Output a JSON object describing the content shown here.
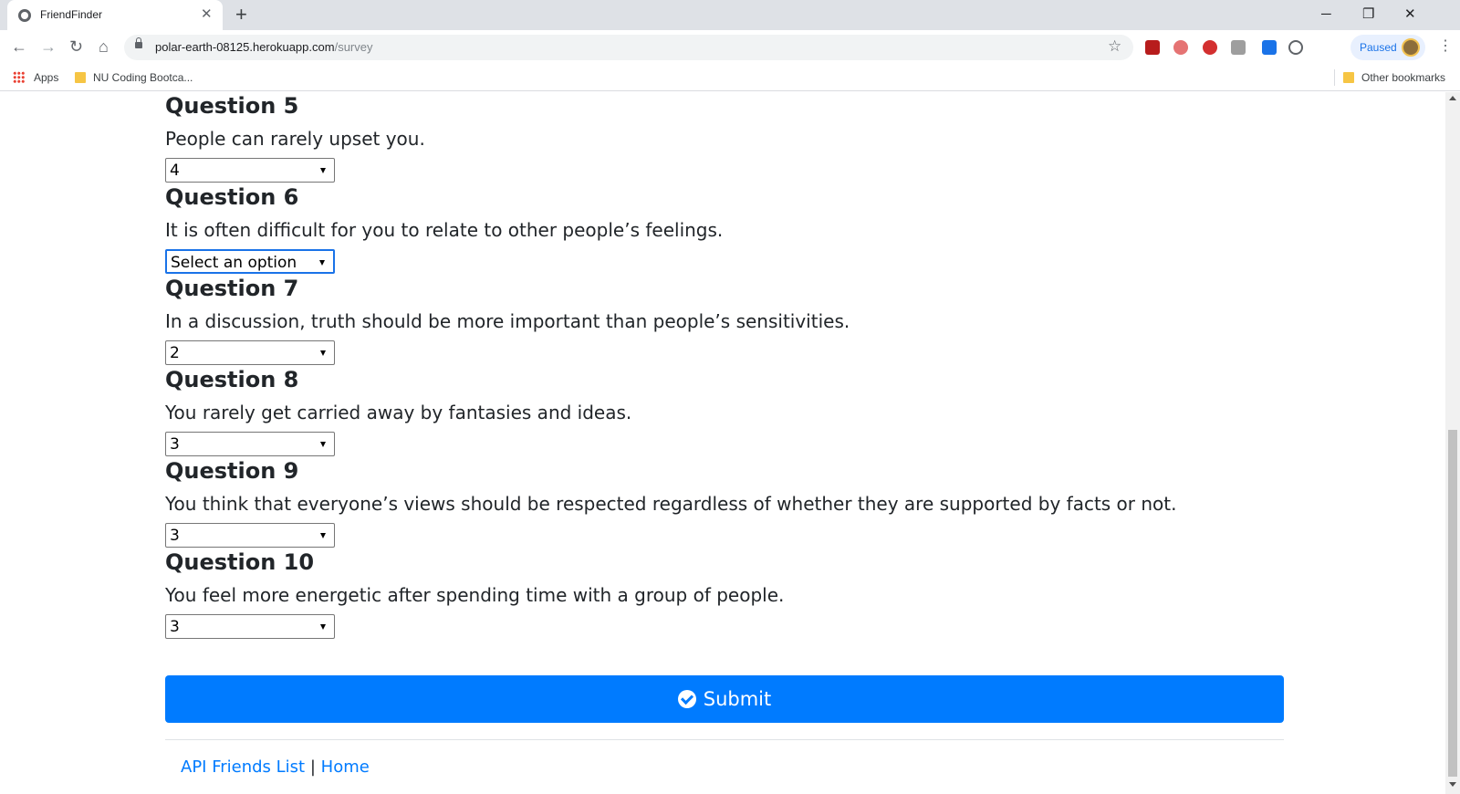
{
  "browser": {
    "tab_title": "FriendFinder",
    "tab_close": "✕",
    "new_tab": "+",
    "url_host": "polar-earth-08125.herokuapp.com",
    "url_path": "/survey",
    "profile_label": "Paused",
    "bookmarks": {
      "apps": "Apps",
      "folder1": "NU Coding Bootca...",
      "other": "Other bookmarks"
    },
    "icons": {
      "back": "←",
      "forward": "→",
      "reload": "↻",
      "home": "⌂",
      "star": "☆",
      "menu": "⋮",
      "minimize": "─",
      "restore": "❐",
      "close": "✕"
    },
    "extension_colors": [
      "#b71c1c",
      "#e57373",
      "#d32f2f",
      "#9e9e9e",
      "#1a73e8",
      "#5f6368"
    ]
  },
  "survey": {
    "questions": [
      {
        "title": "Question 5",
        "text": "People can rarely upset you.",
        "selected": "4",
        "focused": false
      },
      {
        "title": "Question 6",
        "text": "It is often difficult for you to relate to other people’s feelings.",
        "selected": "Select an option",
        "focused": true
      },
      {
        "title": "Question 7",
        "text": "In a discussion, truth should be more important than people’s sensitivities.",
        "selected": "2",
        "focused": false
      },
      {
        "title": "Question 8",
        "text": "You rarely get carried away by fantasies and ideas.",
        "selected": "3",
        "focused": false
      },
      {
        "title": "Question 9",
        "text": "You think that everyone’s views should be respected regardless of whether they are supported by facts or not.",
        "selected": "3",
        "focused": false
      },
      {
        "title": "Question 10",
        "text": "You feel more energetic after spending time with a group of people.",
        "selected": "3",
        "focused": false
      }
    ],
    "submit_label": "Submit",
    "accent_color": "#007bff"
  },
  "footer": {
    "link1": "API Friends List",
    "separator": "|",
    "link2": "Home"
  }
}
